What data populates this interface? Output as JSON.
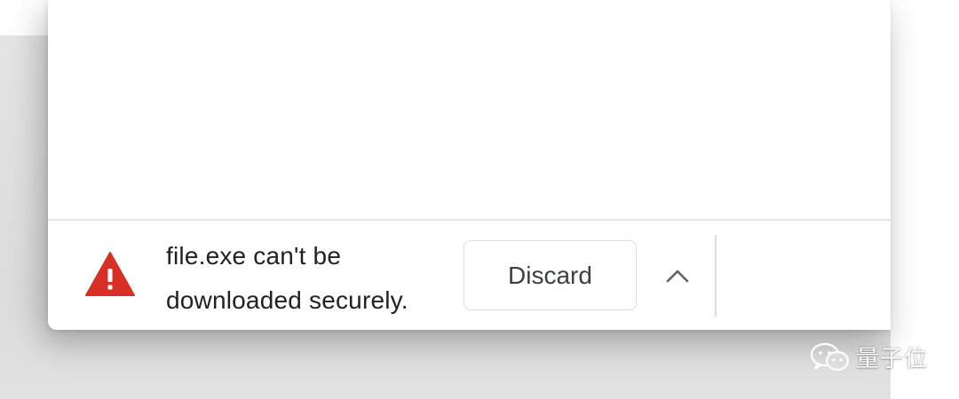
{
  "download_bar": {
    "message_line1": "file.exe can't be",
    "message_line2": "downloaded securely.",
    "discard_label": "Discard",
    "warning_color": "#d93025",
    "expand_icon": "chevron-up-icon"
  },
  "watermark": {
    "text": "量子位",
    "icon": "wechat-icon"
  }
}
